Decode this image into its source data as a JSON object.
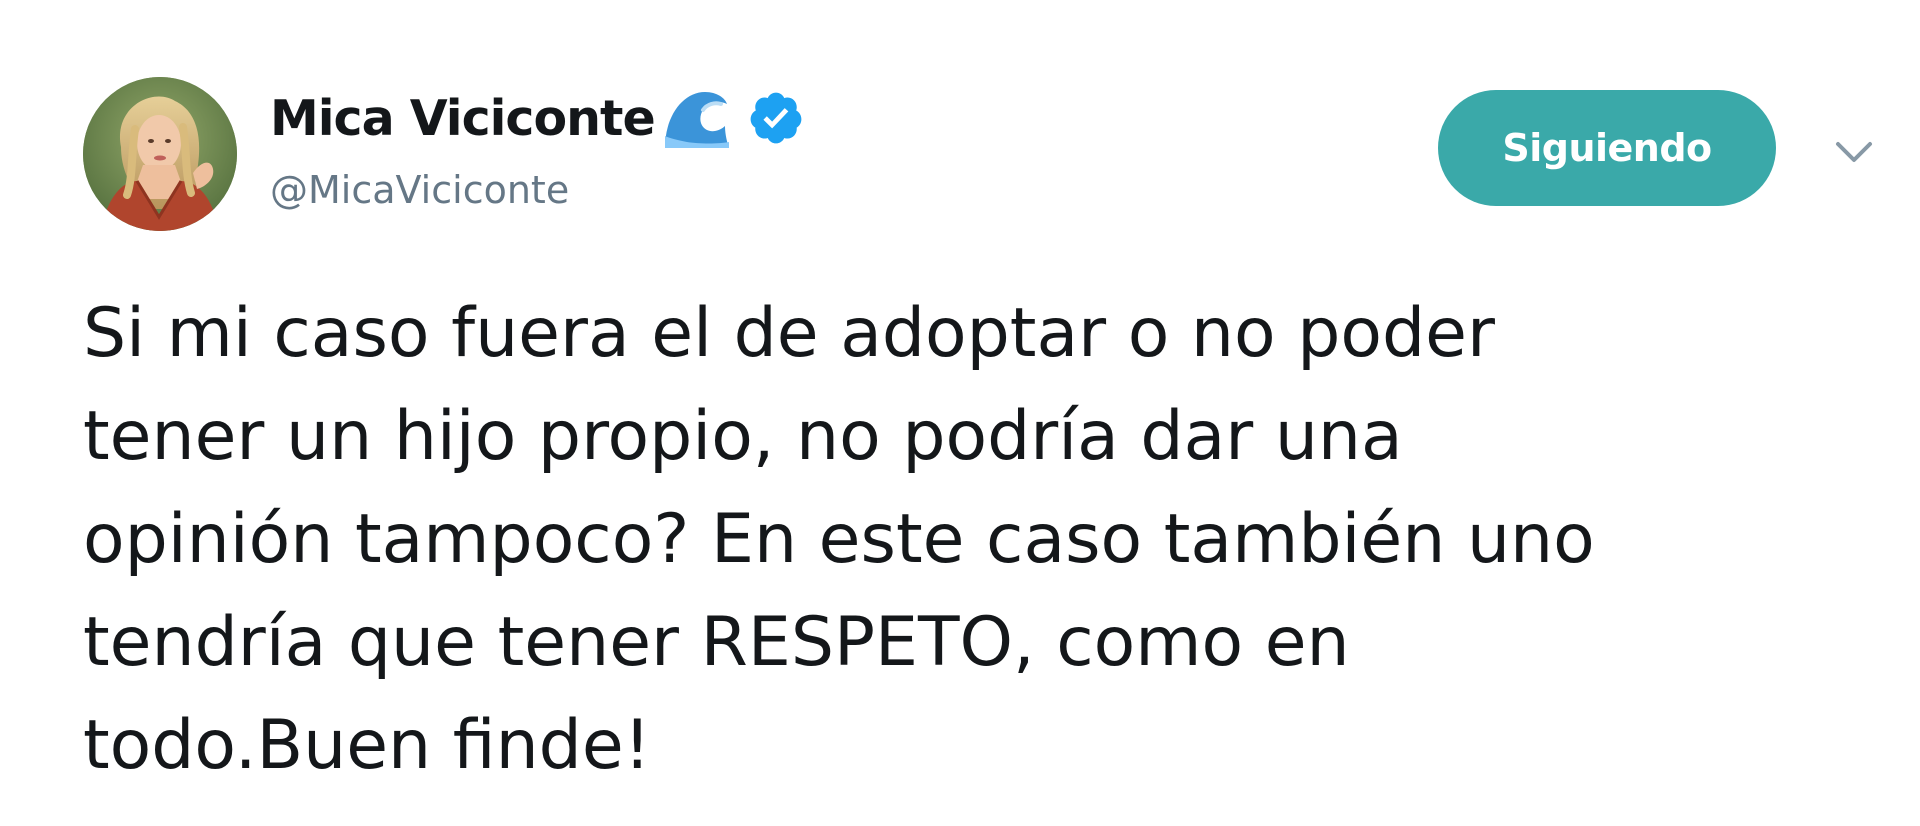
{
  "author": {
    "display_name": "Mica Viciconte",
    "name_emoji": "wave-emoji",
    "verified_icon": "verified-badge-icon",
    "handle": "@MicaViciconte"
  },
  "actions": {
    "follow_label": "Siguiendo",
    "follow_color": "#3aa9a9",
    "more_icon": "chevron-down-icon"
  },
  "tweet": {
    "lines": [
      "Si mi caso fuera el de adoptar o no poder",
      "tener un hijo propio, no podría dar una",
      "opinión tampoco? En este caso también uno",
      "tendría que tener RESPETO, como en",
      "todo.Buen finde!"
    ]
  },
  "colors": {
    "text": "#14171a",
    "secondary": "#657786",
    "verified": "#1da1f2",
    "background": "#ffffff"
  }
}
